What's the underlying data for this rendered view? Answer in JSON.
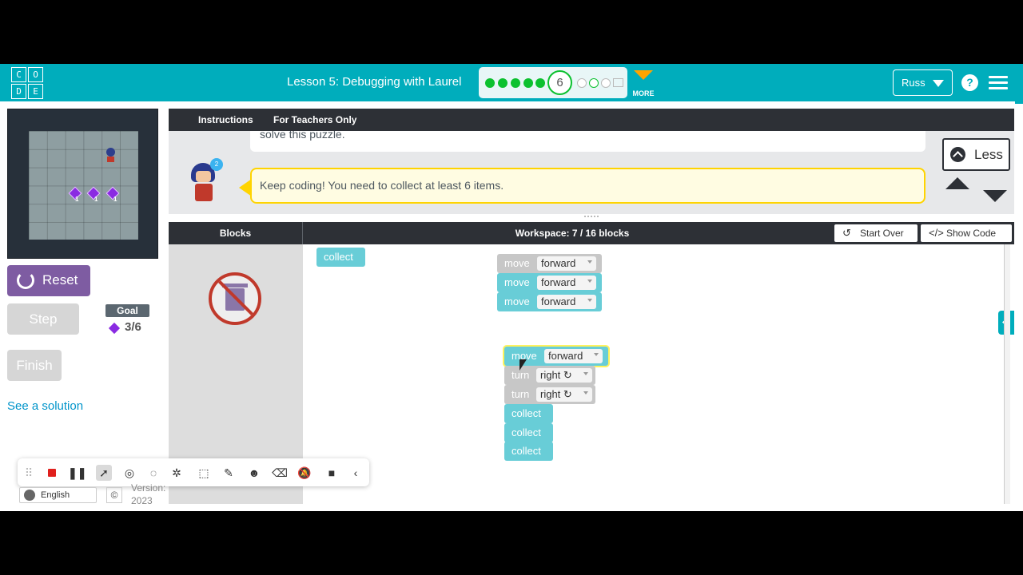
{
  "header": {
    "logo_letters": [
      "C",
      "O",
      "D",
      "E"
    ],
    "lesson_title": "Lesson 5: Debugging with Laurel",
    "current_level": "6",
    "more_label": "MORE",
    "user_name": "Russ",
    "help_label": "?"
  },
  "visualization": {
    "gem_counts": [
      "1",
      "1",
      "1"
    ]
  },
  "controls": {
    "reset_label": "Reset",
    "step_label": "Step",
    "finish_label": "Finish",
    "goal_label": "Goal",
    "goal_value": "3/6",
    "solution_link": "See a solution"
  },
  "instructions": {
    "tabs": [
      "Instructions",
      "For Teachers Only"
    ],
    "previous_text": "solve this puzzle.",
    "current_text": "Keep coding! You need to collect at least 6 items.",
    "hint_count": "2",
    "less_label": "Less"
  },
  "workspace": {
    "blocks_label": "Blocks",
    "count_label": "Workspace: 7 / 16 blocks",
    "start_over_label": "Start Over",
    "show_code_label": "Show Code"
  },
  "code_blocks": {
    "collect": "collect",
    "move": "move",
    "turn": "turn",
    "forward": "forward",
    "right": "right ↻"
  },
  "footer": {
    "language": "English",
    "copyright": "©",
    "version_line1": "Version:",
    "version_line2": "2023"
  },
  "colors": {
    "brand_teal": "#00adbc",
    "reset_purple": "#7e5ca2",
    "collect_block": "#68cdd7",
    "progress_green": "#0cc12f",
    "more_orange": "#ffa400"
  }
}
